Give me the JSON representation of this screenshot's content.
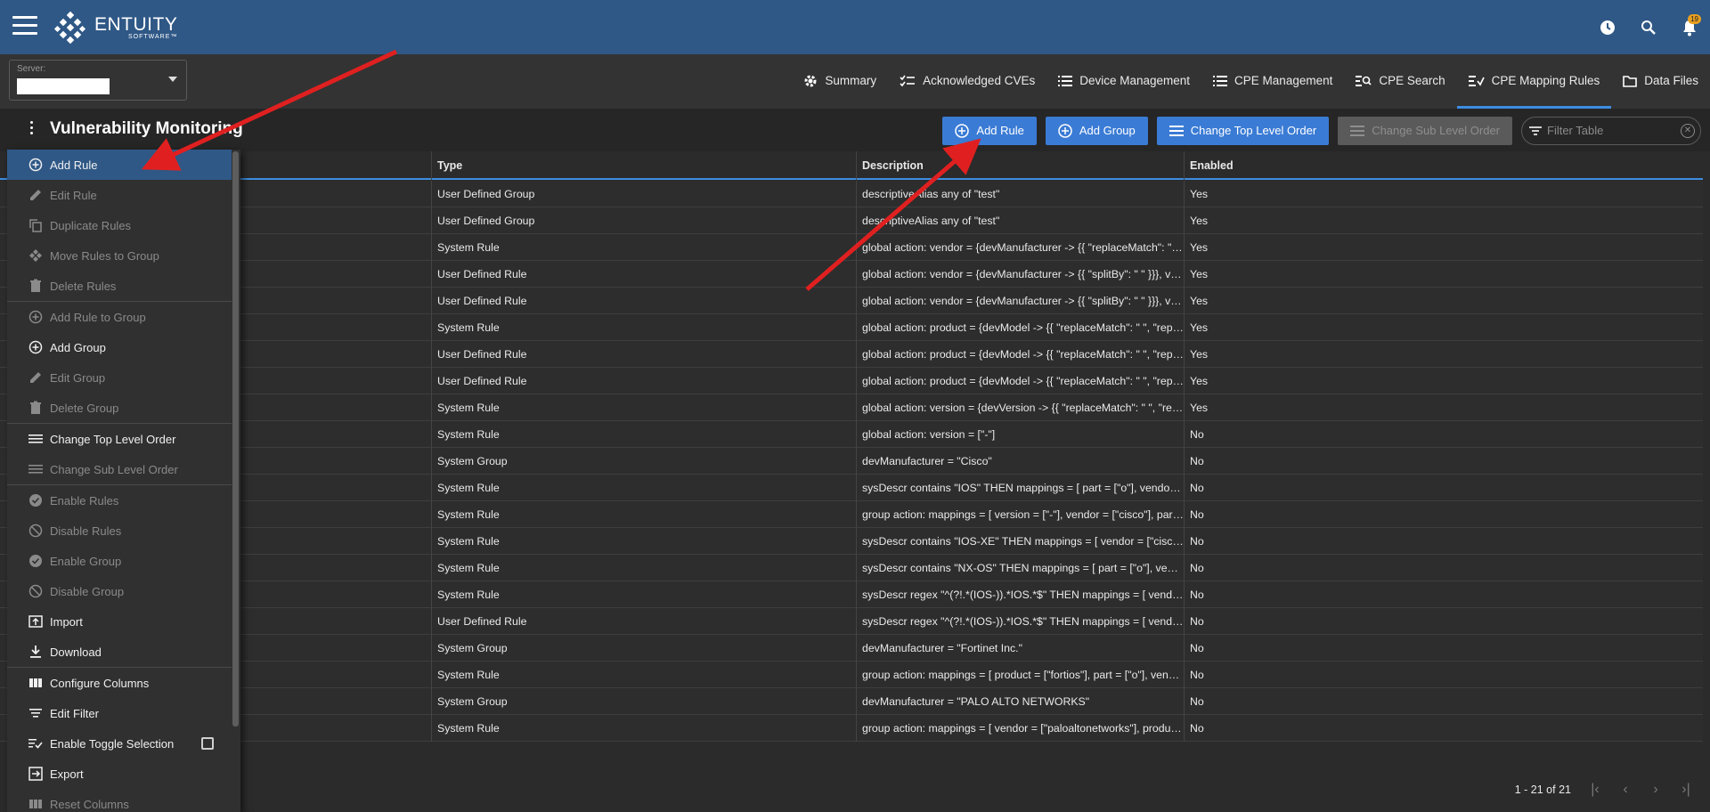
{
  "header": {
    "logo_main": "ENTUITY",
    "logo_sub": "SOFTWARE™",
    "notification_count": "19"
  },
  "server": {
    "label": "Server:",
    "value": ""
  },
  "nav_tabs": [
    {
      "label": "Summary",
      "icon": "gear-icon"
    },
    {
      "label": "Acknowledged CVEs",
      "icon": "checklist-icon"
    },
    {
      "label": "Device Management",
      "icon": "list-icon"
    },
    {
      "label": "CPE Management",
      "icon": "list-icon"
    },
    {
      "label": "CPE Search",
      "icon": "list-search-icon"
    },
    {
      "label": "CPE Mapping Rules",
      "icon": "mapping-icon",
      "active": true
    },
    {
      "label": "Data Files",
      "icon": "folder-icon"
    }
  ],
  "page": {
    "title": "Vulnerability Monitoring"
  },
  "actions": {
    "add_rule": "Add Rule",
    "add_group": "Add Group",
    "change_top": "Change Top Level Order",
    "change_sub": "Change Sub Level Order",
    "filter_placeholder": "Filter Table"
  },
  "table": {
    "headers": [
      "Type",
      "Description",
      "Enabled"
    ],
    "rows": [
      [
        "User Defined Group",
        "descriptiveAlias any of \"test\"",
        "Yes"
      ],
      [
        "User Defined Group",
        "descriptiveAlias any of \"test\"",
        "Yes"
      ],
      [
        "System Rule",
        "global action: vendor = {devManufacturer -> {{ \"replaceMatch\": \" \", ...",
        "Yes"
      ],
      [
        "User Defined Rule",
        "global action: vendor = {devManufacturer -> {{ \"splitBy\": \" \" }}}, ven...",
        "Yes"
      ],
      [
        "User Defined Rule",
        "global action: vendor = {devManufacturer -> {{ \"splitBy\": \" \" }}}, ven...",
        "Yes"
      ],
      [
        "System Rule",
        "global action: product = {devModel -> {{ \"replaceMatch\": \" \", \"repla...",
        "Yes"
      ],
      [
        "User Defined Rule",
        "global action: product = {devModel -> {{ \"replaceMatch\": \" \", \"repla...",
        "Yes"
      ],
      [
        "User Defined Rule",
        "global action: product = {devModel -> {{ \"replaceMatch\": \" \", \"repla...",
        "Yes"
      ],
      [
        "System Rule",
        "global action: version = {devVersion -> {{ \"replaceMatch\": \" \", \"repla...",
        "Yes"
      ],
      [
        "System Rule",
        "global action: version = [\"-\"]",
        "No"
      ],
      [
        "System Group",
        "devManufacturer = \"Cisco\"",
        "No"
      ],
      [
        "System Rule",
        "sysDescr contains \"IOS\" THEN mappings = [ part = [\"o\"], vendor = [...",
        "No"
      ],
      [
        "System Rule",
        "group action: mappings = [ version = [\"-\"], vendor = [\"cisco\"], part = ...",
        "No"
      ],
      [
        "System Rule",
        "sysDescr contains \"IOS-XE\" THEN mappings = [ vendor = [\"cisco\"], ...",
        "No"
      ],
      [
        "System Rule",
        "sysDescr contains \"NX-OS\" THEN mappings = [ part = [\"o\"], vendor...",
        "No"
      ],
      [
        "System Rule",
        "sysDescr regex \"^(?!.*(IOS-)).*IOS.*$\" THEN mappings = [ vendor =...",
        "No"
      ],
      [
        "User Defined Rule",
        "sysDescr regex \"^(?!.*(IOS-)).*IOS.*$\" THEN mappings = [ vendor =...",
        "No"
      ],
      [
        "System Group",
        "devManufacturer = \"Fortinet Inc.\"",
        "No"
      ],
      [
        "System Rule",
        "group action: mappings = [ product = [\"fortios\"], part = [\"o\"], vendor...",
        "No"
      ],
      [
        "System Group",
        "devManufacturer = \"PALO ALTO NETWORKS\"",
        "No"
      ],
      [
        "System Rule",
        "group action: mappings = [ vendor = [\"paloaltonetworks\"], product ...",
        "No"
      ]
    ]
  },
  "pager": {
    "range": "1 - 21 of 21"
  },
  "menu": {
    "items": [
      {
        "label": "Add Rule",
        "icon": "add-circle-icon",
        "disabled": false,
        "selected": true
      },
      {
        "label": "Edit Rule",
        "icon": "pencil-icon",
        "disabled": true
      },
      {
        "label": "Duplicate Rules",
        "icon": "duplicate-icon",
        "disabled": true
      },
      {
        "label": "Move Rules to Group",
        "icon": "move-icon",
        "disabled": true
      },
      {
        "label": "Delete Rules",
        "icon": "trash-icon",
        "disabled": true,
        "sep_after": true
      },
      {
        "label": "Add Rule to Group",
        "icon": "add-circle-icon",
        "disabled": true
      },
      {
        "label": "Add Group",
        "icon": "add-circle-icon",
        "disabled": false
      },
      {
        "label": "Edit Group",
        "icon": "pencil-icon",
        "disabled": true
      },
      {
        "label": "Delete Group",
        "icon": "trash-icon",
        "disabled": true,
        "sep_after": true
      },
      {
        "label": "Change Top Level Order",
        "icon": "lines-icon",
        "disabled": false
      },
      {
        "label": "Change Sub Level Order",
        "icon": "lines-icon",
        "disabled": true,
        "sep_after": true
      },
      {
        "label": "Enable Rules",
        "icon": "check-circle-icon",
        "disabled": true
      },
      {
        "label": "Disable Rules",
        "icon": "disable-icon",
        "disabled": true
      },
      {
        "label": "Enable Group",
        "icon": "check-circle-icon",
        "disabled": true
      },
      {
        "label": "Disable Group",
        "icon": "disable-icon",
        "disabled": true
      },
      {
        "label": "Import",
        "icon": "upload-icon",
        "disabled": false
      },
      {
        "label": "Download",
        "icon": "download-icon",
        "disabled": false,
        "sep_after": true
      },
      {
        "label": "Configure Columns",
        "icon": "columns-icon",
        "disabled": false
      },
      {
        "label": "Edit Filter",
        "icon": "filter-icon",
        "disabled": false
      },
      {
        "label": "Enable Toggle Selection",
        "icon": "toggle-list-icon",
        "disabled": false,
        "checkbox": true
      },
      {
        "label": "Export",
        "icon": "export-icon",
        "disabled": false
      },
      {
        "label": "Reset Columns",
        "icon": "columns-icon",
        "disabled": true
      }
    ]
  },
  "colors": {
    "header_bg": "#2f5886",
    "accent": "#3a7bd5",
    "annotation_arrow": "#e02020"
  }
}
